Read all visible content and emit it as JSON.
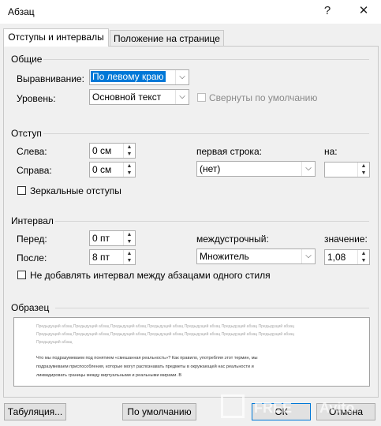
{
  "window": {
    "title": "Абзац",
    "help_glyph": "?",
    "close_glyph": "✕"
  },
  "tabs": [
    {
      "label": "Отступы и интервалы",
      "active": true
    },
    {
      "label": "Положение на странице",
      "active": false
    }
  ],
  "general": {
    "title": "Общие",
    "alignment_label": "Выравнивание:",
    "alignment_value": "По левому краю",
    "level_label": "Уровень:",
    "level_value": "Основной текст",
    "collapsed_label": "Свернуты по умолчанию",
    "collapsed_checked": false
  },
  "indent": {
    "title": "Отступ",
    "left_label": "Слева:",
    "left_value": "0 см",
    "right_label": "Справа:",
    "right_value": "0 см",
    "first_line_label": "первая строка:",
    "first_line_value": "(нет)",
    "by_label": "на:",
    "by_value": "",
    "mirror_label": "Зеркальные отступы",
    "mirror_checked": false
  },
  "spacing": {
    "title": "Интервал",
    "before_label": "Перед:",
    "before_value": "0 пт",
    "after_label": "После:",
    "after_value": "8 пт",
    "line_label": "междустрочный:",
    "line_value": "Множитель",
    "at_label": "значение:",
    "at_value": "1,08",
    "dont_add_label": "Не добавлять интервал между абзацами одного стиля",
    "dont_add_checked": false
  },
  "preview": {
    "title": "Образец",
    "prev_lines": [
      "Предыдущий абзац Предыдущий абзац Предыдущий абзац Предыдущий абзац Предыдущий абзац Предыдущий абзац Предыдущий абзац",
      "Предыдущий абзац Предыдущий абзац Предыдущий абзац Предыдущий абзац Предыдущий абзац Предыдущий абзац Предыдущий абзац",
      "Предыдущий абзац"
    ],
    "sample_lines": [
      "Что мы подразумеваем под понятием «смешанная реальность»? Как правило, употребляя этот термин, мы",
      "подразумеваем приспособления, которые могут распознавать предметы в окружающей нас реальности и",
      "ликвидировать границы между виртуальными и реальными мирами. В"
    ]
  },
  "buttons": {
    "tabs": "Табуляция...",
    "default": "По умолчанию",
    "ok": "ОК",
    "cancel": "Отмена"
  },
  "watermark": {
    "left": "FREE",
    "right": "Avito"
  },
  "icons": {
    "dropdown": "chevron-down-icon",
    "spin_up": "spin-up-icon",
    "spin_down": "spin-down-icon"
  }
}
